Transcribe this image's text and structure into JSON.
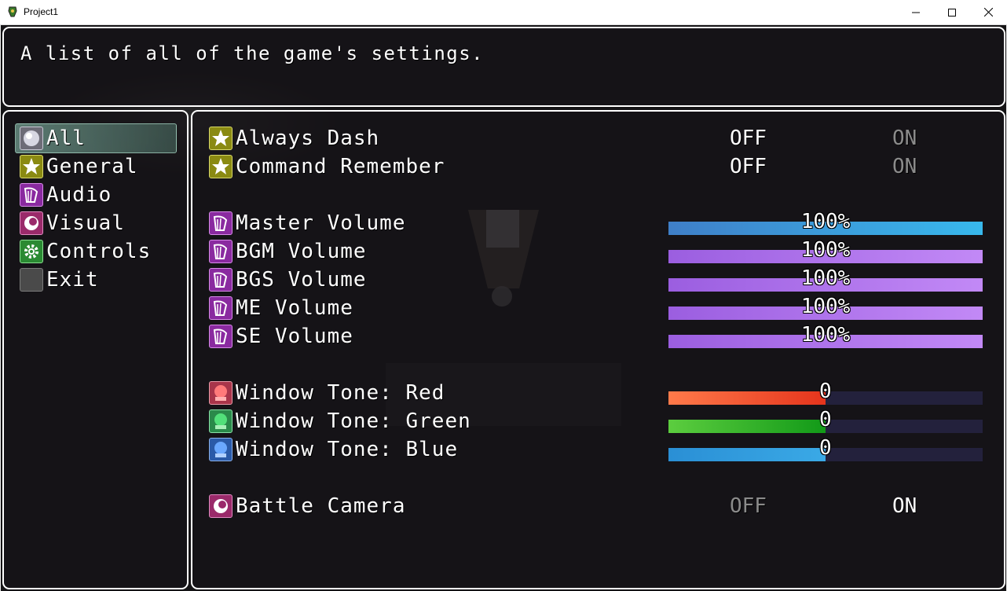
{
  "window": {
    "title": "Project1"
  },
  "help_text": "A list of all of the game's settings.",
  "categories": [
    {
      "label": "All",
      "icon": "orb-icon"
    },
    {
      "label": "General",
      "icon": "star-icon"
    },
    {
      "label": "Audio",
      "icon": "harp-icon"
    },
    {
      "label": "Visual",
      "icon": "eye-icon"
    },
    {
      "label": "Controls",
      "icon": "gear-icon"
    },
    {
      "label": "Exit",
      "icon": "blank-icon"
    }
  ],
  "selected_category": "All",
  "toggle_off_label": "OFF",
  "toggle_on_label": "ON",
  "options": {
    "always_dash": {
      "label": "Always Dash",
      "value": "OFF"
    },
    "command_remember": {
      "label": "Command Remember",
      "value": "OFF"
    },
    "master_volume": {
      "label": "Master Volume",
      "display": "100%",
      "fraction": 1.0
    },
    "bgm_volume": {
      "label": "BGM Volume",
      "display": "100%",
      "fraction": 1.0
    },
    "bgs_volume": {
      "label": "BGS Volume",
      "display": "100%",
      "fraction": 1.0
    },
    "me_volume": {
      "label": "ME Volume",
      "display": "100%",
      "fraction": 1.0
    },
    "se_volume": {
      "label": "SE Volume",
      "display": "100%",
      "fraction": 1.0
    },
    "tone_red": {
      "label": "Window Tone: Red",
      "display": "0",
      "fraction": 0.5
    },
    "tone_green": {
      "label": "Window Tone: Green",
      "display": "0",
      "fraction": 0.5
    },
    "tone_blue": {
      "label": "Window Tone: Blue",
      "display": "0",
      "fraction": 0.5
    },
    "battle_camera": {
      "label": "Battle Camera",
      "value": "ON"
    }
  },
  "colors": {
    "master_gauge": [
      "#3f7fc8",
      "#38b8ec"
    ],
    "volume_gauge": [
      "#9b5ee0",
      "#c289f6"
    ],
    "red_gauge": [
      "#ff7a4a",
      "#e5341c"
    ],
    "green_gauge": [
      "#5ccd3f",
      "#129a18"
    ],
    "blue_gauge": [
      "#2a8fd5",
      "#3aa9e6"
    ]
  }
}
